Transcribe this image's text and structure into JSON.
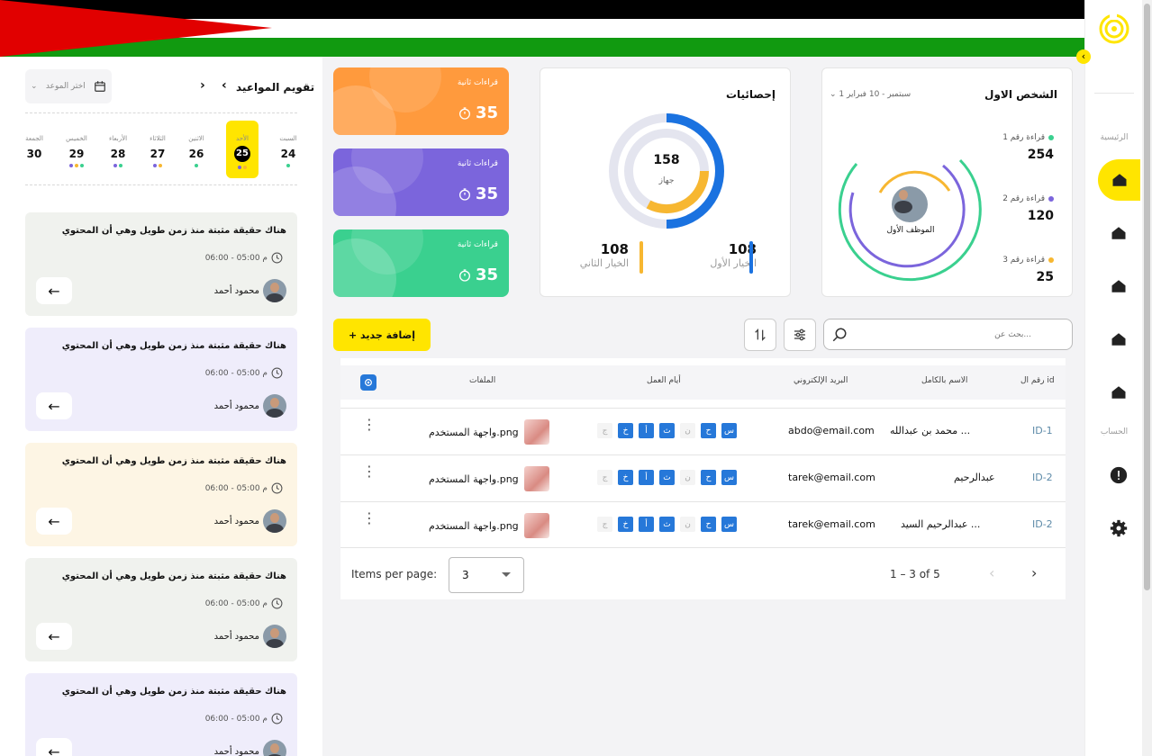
{
  "sidebar": {
    "section_main": "الرئيسية",
    "section_account": "الحساب",
    "collapse_glyph": "‹"
  },
  "calendar": {
    "title": "تقويم المواعيد",
    "prev_glyph": "‹",
    "next_glyph": "›",
    "date_picker_placeholder": "اختر الموعد",
    "days": [
      {
        "name": "السبت",
        "date": "24"
      },
      {
        "name": "الأحد",
        "date": "25"
      },
      {
        "name": "الاثنين",
        "date": "26"
      },
      {
        "name": "الثلاثاء",
        "date": "27"
      },
      {
        "name": "الأربعاء",
        "date": "28"
      },
      {
        "name": "الخميس",
        "date": "29"
      },
      {
        "name": "الجمعة",
        "date": "30"
      }
    ],
    "selected_day_index": 1
  },
  "appointments": [
    {
      "title": "هناك حقيقة مثبتة منذ زمن طويل وهي أن المحتوي",
      "time": "م 05:00 - 06:00",
      "person": "محمود أحمد",
      "bg": "#f0f2ee"
    },
    {
      "title": "هناك حقيقة مثبتة منذ زمن طويل وهي أن المحتوي",
      "time": "م 05:00 - 06:00",
      "person": "محمود أحمد",
      "bg": "#efedfb"
    },
    {
      "title": "هناك حقيقة مثبتة منذ زمن طويل وهي أن المحتوي",
      "time": "م 05:00 - 06:00",
      "person": "محمود أحمد",
      "bg": "#fdf5e4"
    },
    {
      "title": "هناك حقيقة مثبتة منذ زمن طويل وهي أن المحتوي",
      "time": "م 05:00 - 06:00",
      "person": "محمود أحمد",
      "bg": "#f0f2ee"
    },
    {
      "title": "هناك حقيقة مثبتة منذ زمن طويل وهي أن المحتوي",
      "time": "م 05:00 - 06:00",
      "person": "محمود أحمد",
      "bg": "#efedfb"
    }
  ],
  "stat_cards": [
    {
      "label": "قراءات ثانية",
      "value": "35",
      "color": "#ff9a3d"
    },
    {
      "label": "قراءات ثانية",
      "value": "35",
      "color": "#7b65dc"
    },
    {
      "label": "قراءات ثانية",
      "value": "35",
      "color": "#3ad08f"
    }
  ],
  "statistics": {
    "title": "إحصائيات",
    "center_value": "158",
    "center_label": "جهاز",
    "option1_value": "108",
    "option1_label": "الخيار الأول",
    "option2_value": "108",
    "option2_label": "الخيار الثاني",
    "option1_color": "#1a72e0",
    "option2_color": "#f7b731"
  },
  "person_card": {
    "title": "الشخص الاول",
    "date_range": "1 سبتمبر - 10 فبراير",
    "employee_label": "الموظف الأول",
    "readings": [
      {
        "label": "قراءة رقم 1",
        "value": "254",
        "color": "#3ad08f"
      },
      {
        "label": "قراءة رقم 2",
        "value": "120",
        "color": "#7b65dc"
      },
      {
        "label": "قراءة رقم 3",
        "value": "25",
        "color": "#f7b731"
      }
    ]
  },
  "toolbar": {
    "add_label": "+ إضافة جديد",
    "search_placeholder": "بحث عن..."
  },
  "table": {
    "headers": {
      "id": "رقم ال id",
      "name": "الاسم بالكامل",
      "email": "البريد الإلكتروني",
      "days": "أيام العمل",
      "files": "الملفات"
    },
    "day_letters": [
      "س",
      "ح",
      "ن",
      "ث",
      "أ",
      "خ",
      "ج"
    ],
    "day_active": [
      true,
      true,
      false,
      true,
      true,
      true,
      false
    ],
    "rows": [
      {
        "id": "ID-1",
        "name": "محمد بن عبدالله ...",
        "email": "abdo@email.com",
        "file": "واجهة المستخدم.png"
      },
      {
        "id": "ID-2",
        "name": "عبدالرحيم",
        "email": "tarek@email.com",
        "file": "واجهة المستخدم.png"
      },
      {
        "id": "ID-2",
        "name": "عبدالرحيم السيد ...",
        "email": "tarek@email.com",
        "file": "واجهة المستخدم.png"
      }
    ],
    "pager": {
      "items_per_page_label": "Items per page:",
      "items_per_page_value": "3",
      "range": "1 – 3 of 5"
    }
  }
}
